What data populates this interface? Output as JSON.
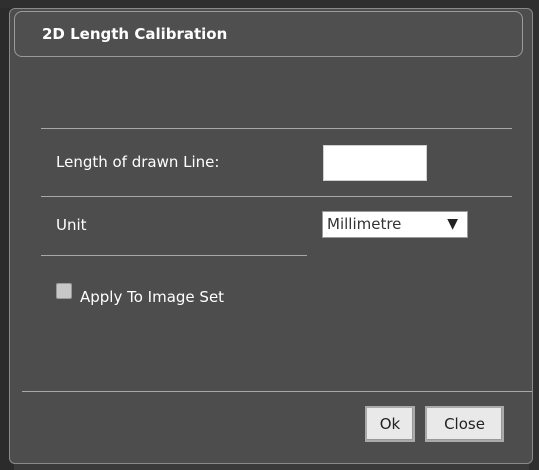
{
  "dialog": {
    "title": "2D Length Calibration",
    "length_label": "Length of drawn Line:",
    "length_value": "",
    "unit_label": "Unit",
    "unit_selected": "Millimetre",
    "apply_label": "Apply To Image Set",
    "ok_label": "Ok",
    "close_label": "Close"
  }
}
